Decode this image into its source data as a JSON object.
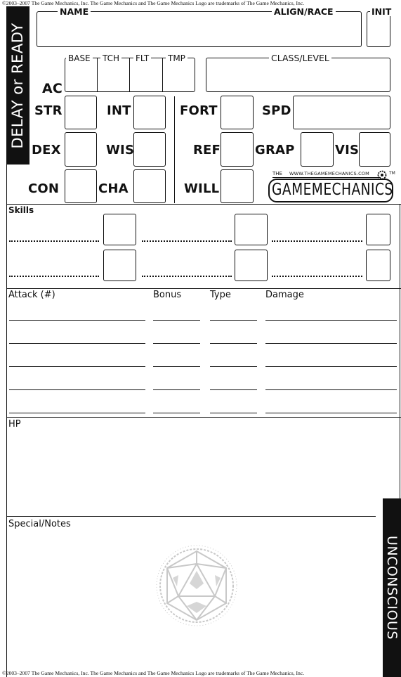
{
  "legal": {
    "top": "©2003–2007 The Game Mechanics, Inc. The Game Mechanics and The Game Mechanics Logo are trademarks of The Game Mechanics, Inc.",
    "bottom": "©2003–2007 The Game Mechanics, Inc. The Game Mechanics and The Game Mechanics Logo are trademarks of The Game Mechanics, Inc."
  },
  "side_tabs": {
    "left": "DELAY or READY",
    "right": "UNCONSCIOUS"
  },
  "header": {
    "name": "NAME",
    "align_race": "ALIGN/RACE",
    "init": "INIT"
  },
  "ac": {
    "label": "AC",
    "base": "BASE",
    "touch": "TCH",
    "flat": "FLT",
    "temp": "TMP",
    "class_level": "CLASS/LEVEL"
  },
  "abilities": {
    "str": "STR",
    "int": "INT",
    "dex": "DEX",
    "wis": "WIS",
    "con": "CON",
    "cha": "CHA"
  },
  "saves": {
    "fort": "FORT",
    "ref": "REF",
    "will": "WILL"
  },
  "other": {
    "spd": "SPD",
    "grap": "GRAP",
    "vis": "VIS"
  },
  "logo": {
    "url": "WWW.THEGAMEMECHANICS.COM",
    "the": "THE",
    "name": "GAMEMECHANICS",
    "tm": "TM"
  },
  "skills": {
    "title": "Skills"
  },
  "attack": {
    "title": "Attack (#)",
    "bonus": "Bonus",
    "type": "Type",
    "damage": "Damage"
  },
  "hp": {
    "title": "HP"
  },
  "notes": {
    "title": "Special/Notes"
  }
}
